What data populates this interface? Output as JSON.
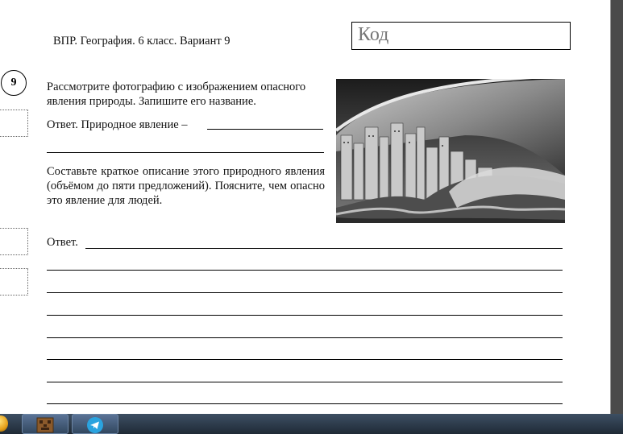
{
  "header": {
    "title": "ВПР. География. 6 класс. Вариант 9",
    "code_label": "Код"
  },
  "task": {
    "number": "9",
    "prompt": "Рассмотрите фотографию с изображением опасного явления природы. Запишите его название.",
    "answer_line": "Ответ. Природное явление –",
    "description": "Составьте краткое описание этого природного явления (объёмом до пяти предложений). Поясните, чем опасно это явление для людей.",
    "answer_label": "Ответ."
  },
  "taskbar": {
    "icons": [
      "start-orb-icon",
      "minecraft-icon",
      "telegram-icon"
    ]
  }
}
